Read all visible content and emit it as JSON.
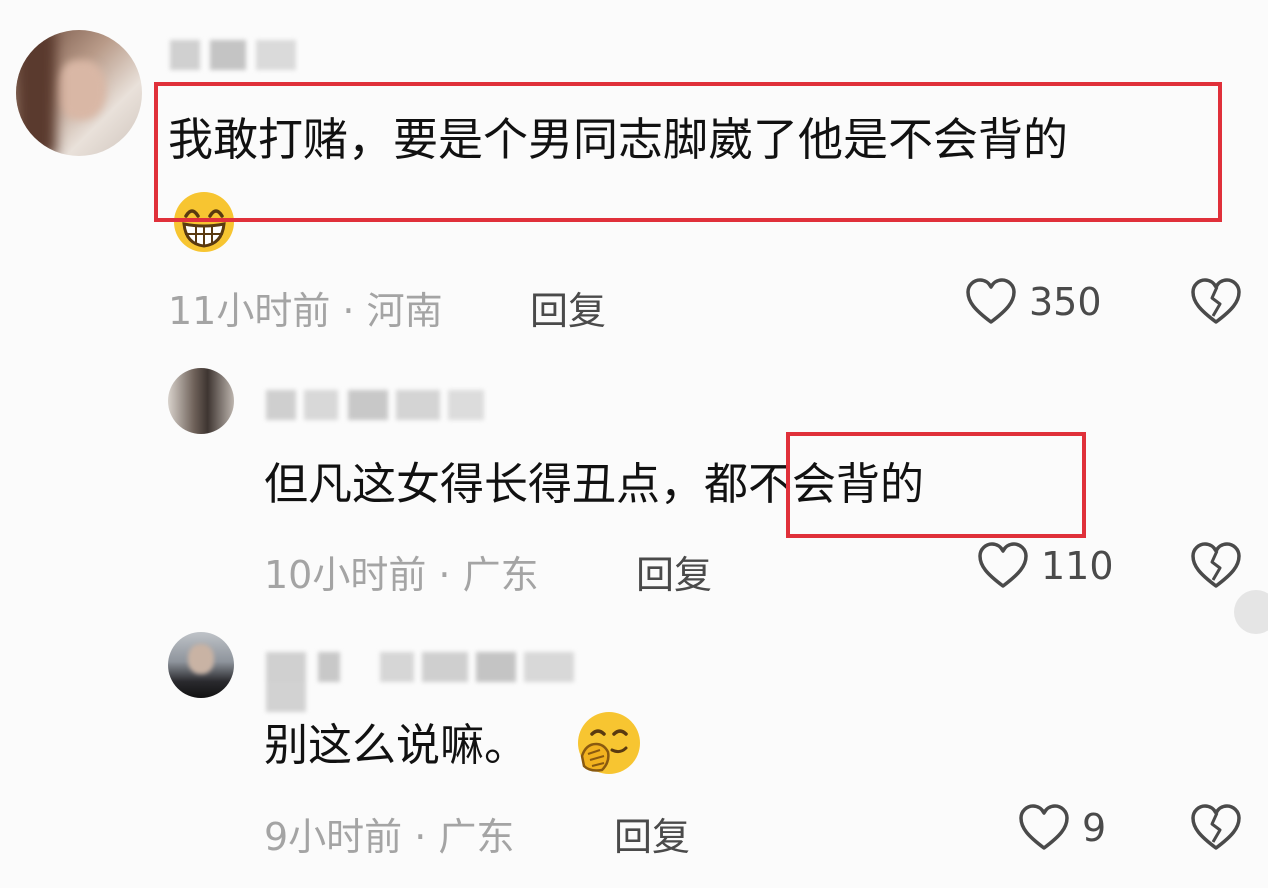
{
  "comments": [
    {
      "text": "我敢打赌，要是个男同志脚崴了他是不会背的",
      "time_location": "11小时前 · 河南",
      "reply_label": "回复",
      "likes": "350",
      "emoji": "grinning-face-emoji"
    },
    {
      "text_before_box": "但凡这女得长得丑点，",
      "text_in_box": "都不会背的",
      "time_location": "10小时前 · 广东",
      "reply_label": "回复",
      "likes": "110"
    },
    {
      "text": "别这么说嘛。",
      "time_location": "9小时前 · 广东",
      "reply_label": "回复",
      "likes": "9",
      "emoji": "hand-over-mouth-emoji"
    }
  ],
  "icons": {
    "like": "heart-outline-icon",
    "dislike": "broken-heart-icon"
  },
  "colors": {
    "highlight": "#e0303a",
    "meta_text": "#a4a4a4",
    "body_text": "#111111",
    "emoji_yellow": "#f7c531"
  }
}
